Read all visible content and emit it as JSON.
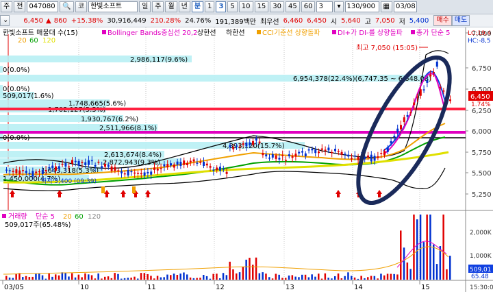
{
  "toolbar": {
    "tab1": "주",
    "tab2": "전",
    "code": "047080",
    "name_prefix": "코",
    "name": "한빛소프트",
    "periods": [
      "일",
      "주",
      "월",
      "년",
      "분",
      "1",
      "3",
      "5",
      "10",
      "15",
      "30",
      "45",
      "60"
    ],
    "selected_minute": "3",
    "mode": "3",
    "count": "130/900",
    "date": "03/08",
    "trade_btn": "매수"
  },
  "quote": {
    "price": "6,450",
    "change_arrow": "▲",
    "change": "860",
    "change_pct": "+15.38%",
    "volume": "30,916,449",
    "vol_ratio": "210.28%",
    "turnover_rate": "24.76%",
    "amount": "191,389백만",
    "best_ask_label": "최우선",
    "best_ask": "6,460",
    "best_bid": "6,450",
    "open_label": "시",
    "open": "5,640",
    "high_label": "고",
    "high": "7,050",
    "low_label": "저",
    "low": "5,400",
    "sell_btn": "매도"
  },
  "legend": {
    "main": "한빛소프트 매물대 수(15)",
    "bb": "Bollinger Bands중심선 20,2",
    "upper": "상한선",
    "lower": "하한선",
    "cci": "CCI기준선 상향돌파",
    "dmi": "DI+가 DI-를 상향돌파",
    "close": "종가 단순 5",
    "ma20": "20",
    "ma60": "60",
    "ma120": "120",
    "lc": "LC:19,4",
    "hc": "HC:-8,5"
  },
  "colors": {
    "up": "#e00000",
    "down": "#0030d0",
    "ma5": "#e000c0",
    "ma20": "#f0a000",
    "ma60": "#00a000",
    "ma120": "#e0e000",
    "profile": "#b8f0f4",
    "bb": "#000000"
  },
  "price_axis": {
    "labels": [
      "7,000",
      "6,750",
      "6,500",
      "6,250",
      "6,000",
      "5,750",
      "5,500",
      "5,250"
    ],
    "current": "6,450",
    "current_pct": "1.74%"
  },
  "volume_profile": [
    {
      "label": "2,986,117(9.6%)"
    },
    {
      "label": "0(0.0%)"
    },
    {
      "label": "6,954,378(22.4%)(6,747.35 ~ 6,648.08)"
    },
    {
      "label": "0(0.0%)"
    },
    {
      "label": "509,017(1.6%)"
    },
    {
      "label": "1,748,665(5.6%)"
    },
    {
      "label": "1,702,127(5.5%)"
    },
    {
      "label": "1,930,767(6.2%)"
    },
    {
      "label": "2,511,966(8.1%)"
    },
    {
      "label": "0(0.0%)"
    },
    {
      "label": "4,893,120(15.7%)"
    },
    {
      "label": "2,613,674(8.4%)"
    },
    {
      "label": "2,872,943(9.3%)"
    },
    {
      "label": "1,643,318(5.3%)"
    },
    {
      "label": "1,450,000(4.7%)"
    }
  ],
  "annotations": {
    "high": "최고 7,050 (15:05)",
    "low": "최저 5,400 (09:39)"
  },
  "volume_panel": {
    "title": "거래량",
    "ma_label": "단순 5",
    "ma20": "20",
    "ma60": "60",
    "ma120": "120",
    "latest": "509,017주(65.48%)",
    "axis": [
      "2,000K",
      "1,000K"
    ],
    "current": "509,01",
    "current_pct": "65.48"
  },
  "x_axis": {
    "labels": [
      "03/05",
      "10",
      "11",
      "12",
      "13",
      "14",
      "15"
    ],
    "time": "15:30:0"
  }
}
